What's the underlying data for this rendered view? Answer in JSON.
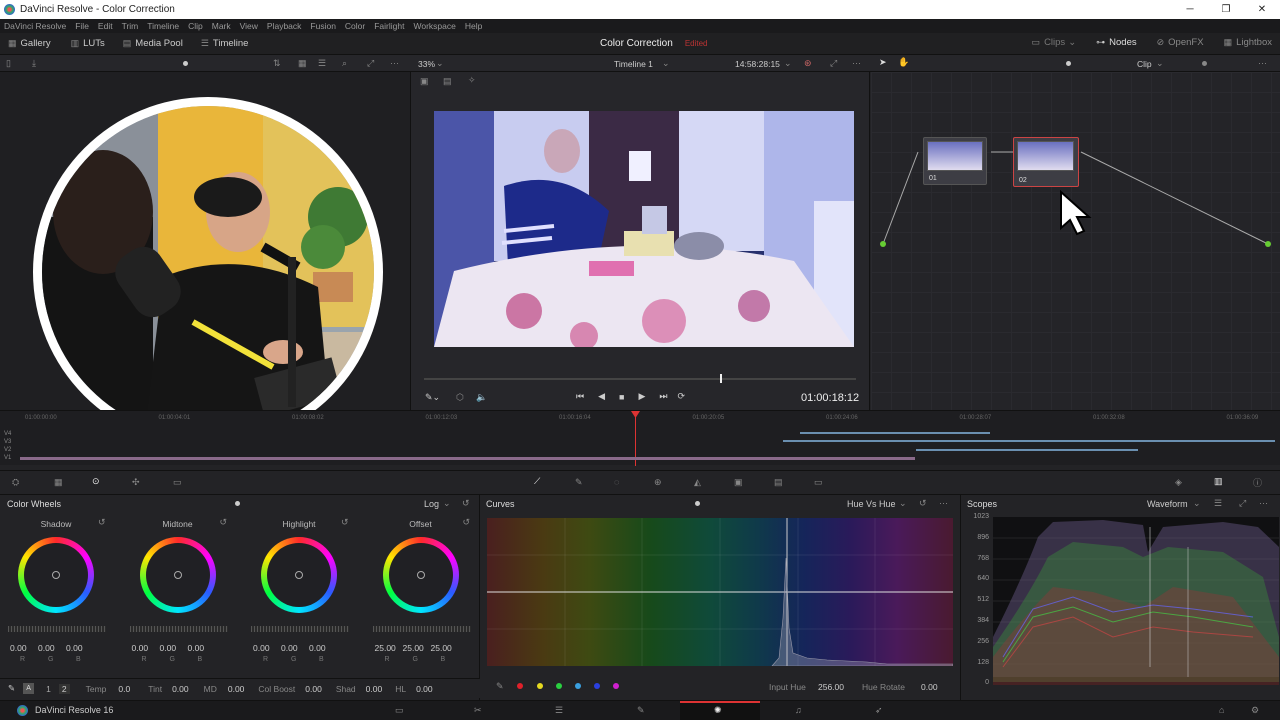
{
  "window": {
    "title": "DaVinci Resolve - Color Correction",
    "min": "─",
    "max": "❐",
    "close": "✕"
  },
  "menu": [
    "DaVinci Resolve",
    "File",
    "Edit",
    "Trim",
    "Timeline",
    "Clip",
    "Mark",
    "View",
    "Playback",
    "Fusion",
    "Color",
    "Fairlight",
    "Workspace",
    "Help"
  ],
  "topbar": {
    "gallery": "Gallery",
    "luts": "LUTs",
    "media_pool": "Media Pool",
    "timeline": "Timeline",
    "page_title": "Color Correction",
    "edited": "Edited",
    "clips": "Clips",
    "nodes": "Nodes",
    "openfx": "OpenFX",
    "lightbox": "Lightbox"
  },
  "viewer": {
    "zoom": "33%",
    "timeline_name": "Timeline 1",
    "source_tc": "14:58:28:15",
    "clip_mode": "Clip",
    "timecode": "01:00:18:12"
  },
  "ruler": [
    "01:00:00:00",
    "01:00:04:01",
    "01:00:08:02",
    "01:00:12:03",
    "01:00:16:04",
    "01:00:20:05",
    "01:00:24:06",
    "01:00:28:07",
    "01:00:32:08",
    "01:00:36:09"
  ],
  "tracks": [
    "V4",
    "V3",
    "V2",
    "V1"
  ],
  "nodes": [
    {
      "label": "01"
    },
    {
      "label": "02"
    }
  ],
  "color_wheels": {
    "title": "Color Wheels",
    "mode": "Log",
    "wheels": [
      {
        "name": "Shadow",
        "r": "0.00",
        "g": "0.00",
        "b": "0.00"
      },
      {
        "name": "Midtone",
        "r": "0.00",
        "g": "0.00",
        "b": "0.00"
      },
      {
        "name": "Highlight",
        "r": "0.00",
        "g": "0.00",
        "b": "0.00"
      },
      {
        "name": "Offset",
        "r": "25.00",
        "g": "25.00",
        "b": "25.00"
      }
    ],
    "rgb": [
      "R",
      "G",
      "B"
    ]
  },
  "curves": {
    "title": "Curves",
    "mode": "Hue Vs Hue",
    "input_hue_label": "Input Hue",
    "input_hue": "256.00",
    "hue_rotate_label": "Hue Rotate",
    "hue_rotate": "0.00"
  },
  "scopes": {
    "title": "Scopes",
    "mode": "Waveform",
    "scale": [
      "1023",
      "896",
      "768",
      "640",
      "512",
      "384",
      "256",
      "128",
      "0"
    ]
  },
  "bottom_params": {
    "page1": "1",
    "page2": "2",
    "temp_label": "Temp",
    "temp": "0.0",
    "tint_label": "Tint",
    "tint": "0.00",
    "md_label": "MD",
    "md": "0.00",
    "colboost_label": "Col Boost",
    "colboost": "0.00",
    "shad_label": "Shad",
    "shad": "0.00",
    "hl_label": "HL",
    "hl": "0.00"
  },
  "footer": {
    "app": "DaVinci Resolve 16"
  }
}
